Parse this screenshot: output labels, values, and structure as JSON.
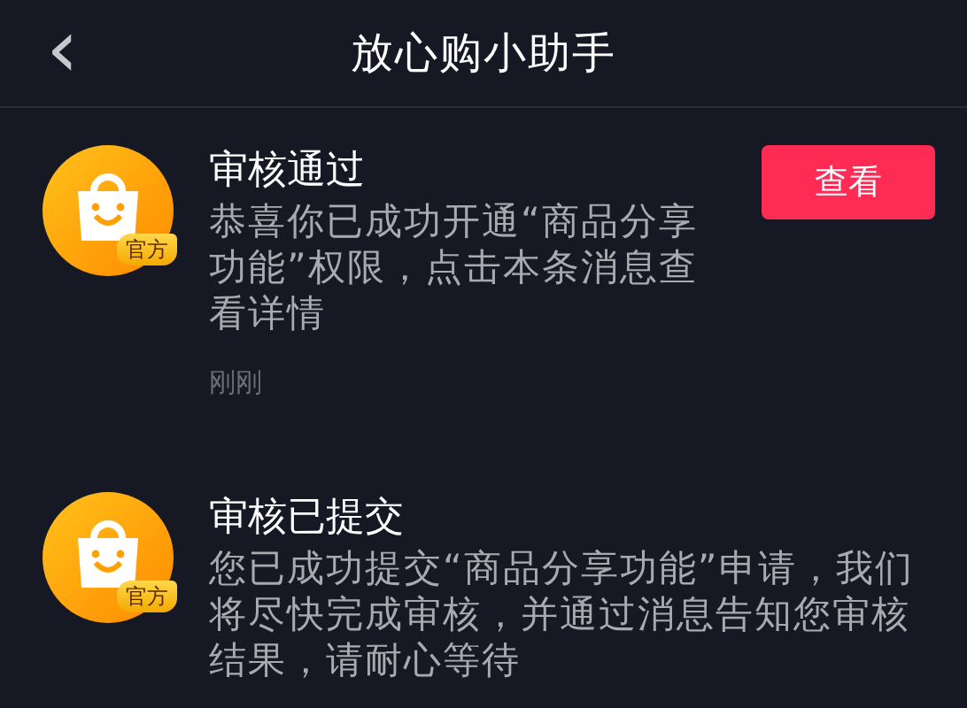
{
  "header": {
    "back": "‹",
    "title": "放心购小助手"
  },
  "messages": [
    {
      "badge": "官方",
      "title": "审核通过",
      "body": "恭喜你已成功开通“商品分享功能”权限，点击本条消息查看详情",
      "time": "刚刚",
      "action": "查看"
    },
    {
      "badge": "官方",
      "title": "审核已提交",
      "body": "您已成功提交“商品分享功能”申请，我们将尽快完成审核，并通过消息告知您审核结果，请耐心等待"
    }
  ]
}
